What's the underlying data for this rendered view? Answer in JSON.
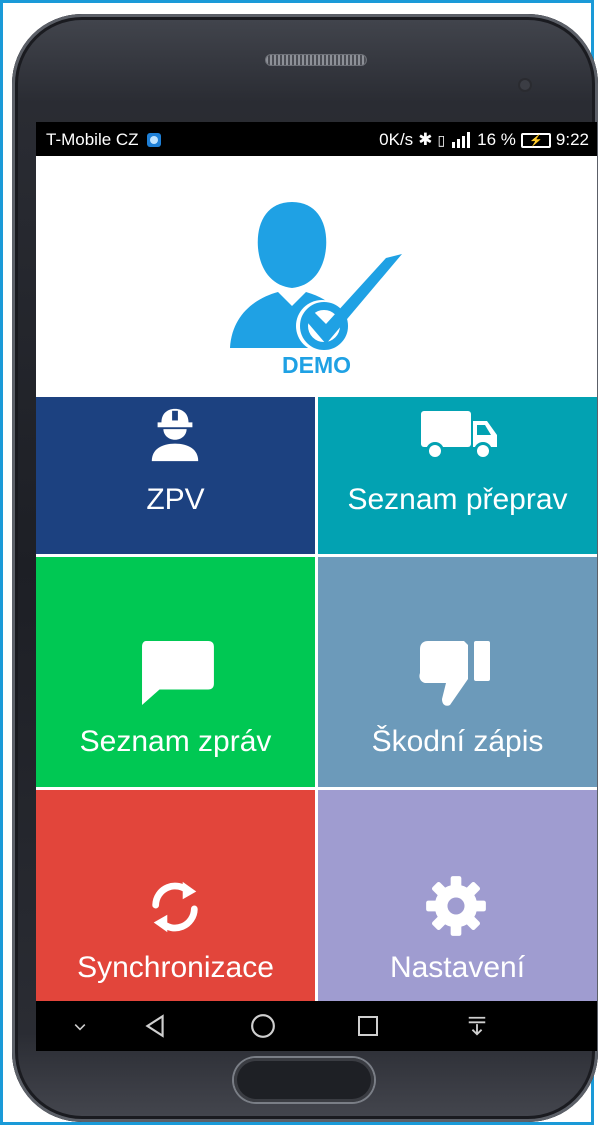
{
  "status_bar": {
    "carrier": "T-Mobile CZ",
    "network_speed": "0K/s",
    "battery_percent": "16 %",
    "time": "9:22"
  },
  "header": {
    "user_name": "DEMO"
  },
  "tiles": [
    {
      "id": "zpv",
      "label": "ZPV",
      "icon": "worker-helmet-icon",
      "color": "#1c4180"
    },
    {
      "id": "seznam-preprav",
      "label": "Seznam přeprav",
      "icon": "truck-icon",
      "color": "#02a2b2"
    },
    {
      "id": "seznam-zprav",
      "label": "Seznam zpráv",
      "icon": "message-bubble-icon",
      "color": "#00c853"
    },
    {
      "id": "skodni-zapis",
      "label": "Škodní zápis",
      "icon": "thumbs-down-icon",
      "color": "#6c9aba"
    },
    {
      "id": "synchronizace",
      "label": "Synchronizace",
      "icon": "sync-icon",
      "color": "#e2453b"
    },
    {
      "id": "nastaveni",
      "label": "Nastavení",
      "icon": "gear-icon",
      "color": "#9f9cd0"
    }
  ],
  "colors": {
    "accent": "#1fa1e4",
    "frame_border": "#1a9ad8"
  }
}
